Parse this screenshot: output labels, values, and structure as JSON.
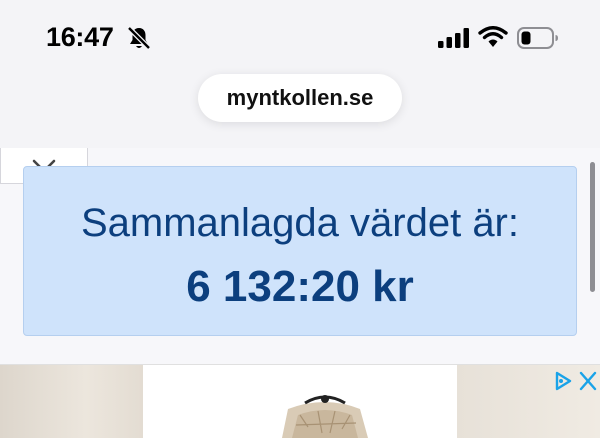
{
  "status_bar": {
    "time": "16:47",
    "icons": [
      "bell-slash-icon",
      "cellular-signal-icon",
      "wifi-icon",
      "battery-icon"
    ]
  },
  "browser": {
    "url": "myntkollen.se"
  },
  "page": {
    "value_label": "Sammanlagda värdet är:",
    "value_amount": "6 132:20 kr",
    "colors": {
      "box_background": "#cfe3fb",
      "box_text": "#0c3f7e"
    }
  },
  "ad": {
    "icons": [
      "ad-choices-icon",
      "close-icon"
    ]
  }
}
